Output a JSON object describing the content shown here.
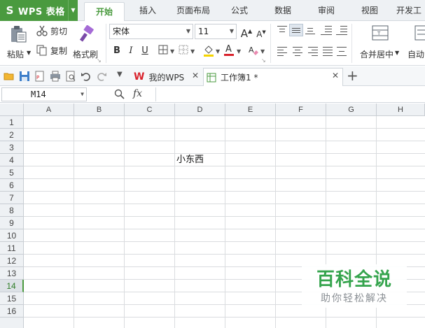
{
  "app": {
    "name": "WPS 表格",
    "logo": "S"
  },
  "menu": {
    "tabs": [
      {
        "label": "开始",
        "active": true
      },
      {
        "label": "插入"
      },
      {
        "label": "页面布局"
      },
      {
        "label": "公式"
      },
      {
        "label": "数据"
      },
      {
        "label": "审阅"
      },
      {
        "label": "视图"
      },
      {
        "label": "开发工"
      }
    ]
  },
  "ribbon": {
    "paste_label": "粘贴",
    "cut_label": "剪切",
    "copy_label": "复制",
    "format_painter_label": "格式刷",
    "font_name": "宋体",
    "font_size": "11",
    "bold": "B",
    "italic": "I",
    "underline": "U",
    "merge_center_label": "合并居中",
    "autowrap_label": "自动"
  },
  "doc_tabs": [
    {
      "label": "我的WPS",
      "icon": "wps-w-icon"
    },
    {
      "label": "工作簿1 *",
      "icon": "workbook-icon",
      "active": true
    }
  ],
  "formula_bar": {
    "cell_ref": "M14",
    "fx_label": "fx"
  },
  "grid": {
    "columns": [
      "A",
      "B",
      "C",
      "D",
      "E",
      "F",
      "G",
      "H"
    ],
    "rows": [
      "1",
      "2",
      "3",
      "4",
      "5",
      "6",
      "7",
      "8",
      "9",
      "10",
      "11",
      "12",
      "13",
      "14",
      "15",
      "16"
    ],
    "active_row": "14",
    "cells": [
      {
        "ref": "D4",
        "value": "小东西"
      }
    ]
  },
  "watermark": {
    "main": "百科全说",
    "sub": "助你轻松解决"
  },
  "colors": {
    "accent": "#4a9a3f",
    "watermark_green": "#35a44d",
    "font_color_bar": "#d9232d",
    "fill_color_bar": "#f5d400"
  }
}
